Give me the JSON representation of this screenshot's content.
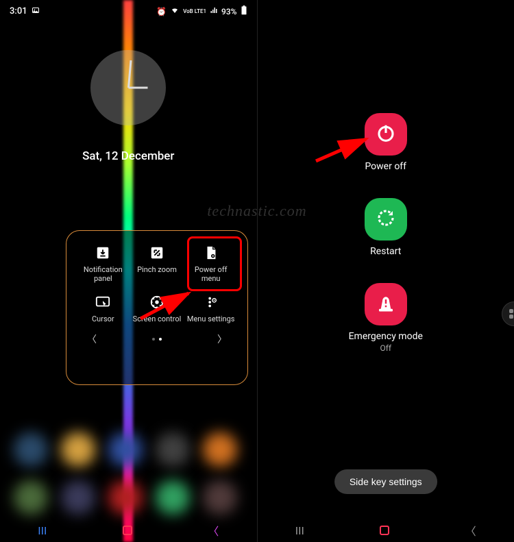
{
  "status_bar": {
    "time": "3:01",
    "network_label": "VoB LTE1",
    "battery": "93%"
  },
  "clock": {
    "date": "Sat, 12 December"
  },
  "assistant_menu": {
    "items": [
      {
        "label": "Notification panel"
      },
      {
        "label": "Pinch zoom"
      },
      {
        "label": "Power off menu"
      },
      {
        "label": "Cursor"
      },
      {
        "label": "Screen control"
      },
      {
        "label": "Menu settings"
      }
    ]
  },
  "power_menu": {
    "power_off": {
      "label": "Power off"
    },
    "restart": {
      "label": "Restart"
    },
    "emergency": {
      "label": "Emergency mode",
      "sublabel": "Off"
    },
    "side_key_label": "Side key settings"
  },
  "watermark": "technastic.com"
}
